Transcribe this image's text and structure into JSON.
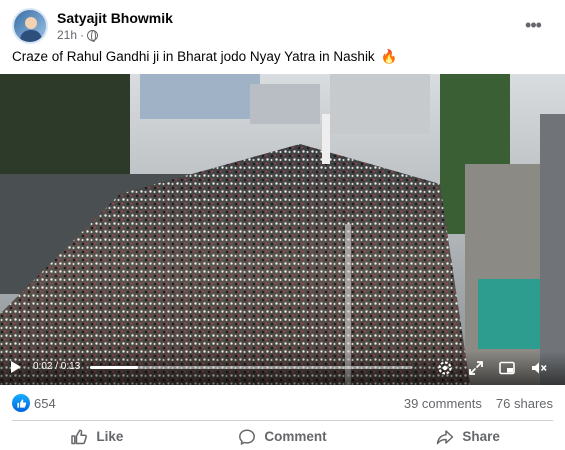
{
  "post": {
    "author": "Satyajit Bhowmik",
    "timestamp": "21h",
    "privacy_icon": "globe-icon",
    "more_icon": "more-options-icon",
    "caption": "Craze of Rahul Gandhi ji in Bharat jodo Nyay Yatra in Nashik",
    "caption_emoji": "🔥"
  },
  "video": {
    "time_display": "0:02 / 0:13",
    "progress": 0.15,
    "controls": [
      "play-icon",
      "settings-icon",
      "fullscreen-icon",
      "picture-in-picture-icon",
      "volume-icon"
    ]
  },
  "stats": {
    "likes": "654",
    "comments": "39 comments",
    "shares": "76 shares"
  },
  "actions": {
    "like": "Like",
    "comment": "Comment",
    "share": "Share"
  },
  "colors": {
    "brand_blue": "#0866ff",
    "secondary_text": "#65676b",
    "divider": "#ced0d4"
  }
}
